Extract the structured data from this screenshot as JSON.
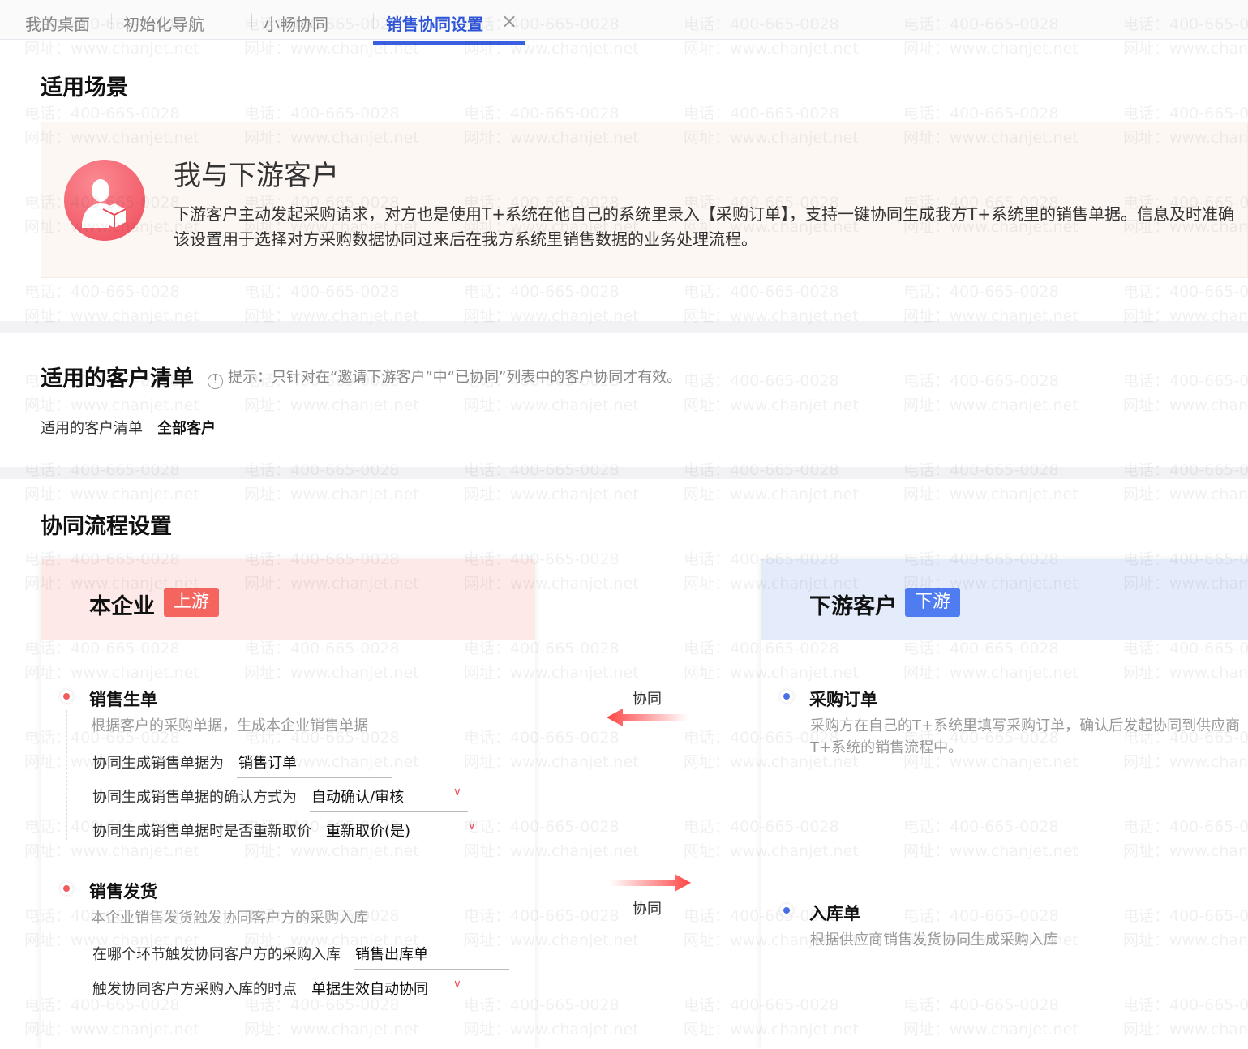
{
  "tabs": [
    {
      "label": "我的桌面"
    },
    {
      "label": "初始化导航"
    },
    {
      "label": "小畅协同"
    },
    {
      "label": "销售协同设置",
      "active": true
    }
  ],
  "close_icon": "×",
  "watermark": {
    "phone": "电话：400-665-0028",
    "site": "网址：www.chanjet.net"
  },
  "scene": {
    "heading": "适用场景",
    "title": "我与下游客户",
    "text1": "下游客户主动发起采购请求，对方也是使用T+系统在他自己的系统里录入【采购订单】，支持一键协同生成我方T+系统里的销售单据。信息及时准确",
    "text2": "该设置用于选择对方采购数据协同过来后在我方系统里销售数据的业务处理流程。"
  },
  "customers": {
    "heading": "适用的客户清单",
    "hint": "提示：只针对在“邀请下游客户”中“已协同”列表中的客户协同才有效。",
    "label": "适用的客户清单",
    "value": "全部客户"
  },
  "flow": {
    "heading": "协同流程设置",
    "left": {
      "title": "本企业",
      "badge": "上游",
      "step1": {
        "title": "销售生单",
        "desc": "根据客户的采购单据，生成本企业销售单据",
        "f1_label": "协同生成销售单据为",
        "f1_value": "销售订单",
        "f2_label": "协同生成销售单据的确认方式为",
        "f2_value": "自动确认/审核",
        "f3_label": "协同生成销售单据时是否重新取价",
        "f3_value": "重新取价(是)"
      },
      "step2": {
        "title": "销售发货",
        "desc": "本企业销售发货触发协同客户方的采购入库",
        "f1_label": "在哪个环节触发协同客户方的采购入库",
        "f1_value": "销售出库单",
        "f2_label": "触发协同客户方采购入库的时点",
        "f2_value": "单据生效自动协同"
      }
    },
    "right": {
      "title": "下游客户",
      "badge": "下游",
      "step1": {
        "title": "采购订单",
        "desc1": "采购方在自己的T+系统里填写采购订单，确认后发起协同到供应商",
        "desc2": "T+系统的销售流程中。"
      },
      "step2": {
        "title": "入库单",
        "desc": "根据供应商销售发货协同生成采购入库"
      }
    },
    "sync_label_1": "协同",
    "sync_label_2": "协同"
  },
  "colors": {
    "accent": "#3a5fe0",
    "upstream": "#f4655f",
    "downstream": "#4f7cf0"
  }
}
